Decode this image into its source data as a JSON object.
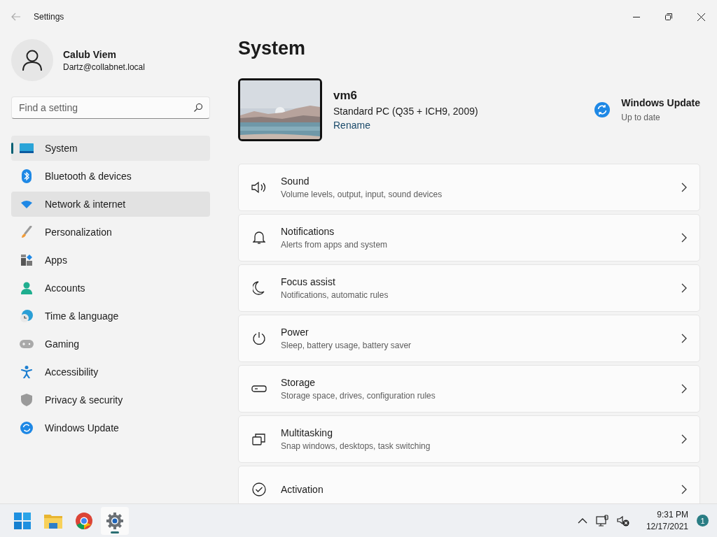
{
  "window": {
    "title": "Settings"
  },
  "profile": {
    "name": "Calub Viem",
    "email": "Dartz@collabnet.local"
  },
  "search": {
    "placeholder": "Find a setting"
  },
  "nav": [
    {
      "label": "System",
      "selected": true,
      "hovered": false
    },
    {
      "label": "Bluetooth & devices",
      "selected": false,
      "hovered": false
    },
    {
      "label": "Network & internet",
      "selected": false,
      "hovered": true
    },
    {
      "label": "Personalization",
      "selected": false,
      "hovered": false
    },
    {
      "label": "Apps",
      "selected": false,
      "hovered": false
    },
    {
      "label": "Accounts",
      "selected": false,
      "hovered": false
    },
    {
      "label": "Time & language",
      "selected": false,
      "hovered": false
    },
    {
      "label": "Gaming",
      "selected": false,
      "hovered": false
    },
    {
      "label": "Accessibility",
      "selected": false,
      "hovered": false
    },
    {
      "label": "Privacy & security",
      "selected": false,
      "hovered": false
    },
    {
      "label": "Windows Update",
      "selected": false,
      "hovered": false
    }
  ],
  "page": {
    "title": "System"
  },
  "device": {
    "kind": "picture",
    "name": "vm6",
    "model": "Standard PC (Q35 + ICH9, 2009)",
    "rename": "Rename"
  },
  "update": {
    "title": "Windows Update",
    "status": "Up to date"
  },
  "cards": [
    {
      "title": "Sound",
      "description": "Volume levels, output, input, sound devices"
    },
    {
      "title": "Notifications",
      "description": "Alerts from apps and system"
    },
    {
      "title": "Focus assist",
      "description": "Notifications, automatic rules"
    },
    {
      "title": "Power",
      "description": "Sleep, battery usage, battery saver"
    },
    {
      "title": "Storage",
      "description": "Storage space, drives, configuration rules"
    },
    {
      "title": "Multitasking",
      "description": "Snap windows, desktops, task switching"
    },
    {
      "title": "Activation"
    }
  ],
  "taskbar": {
    "apps": [
      {
        "selected": false
      },
      {
        "selected": false
      },
      {
        "selected": false
      },
      {
        "selected": true
      }
    ],
    "time": "9:31 PM",
    "date": "12/17/2021",
    "notifications": "1"
  }
}
